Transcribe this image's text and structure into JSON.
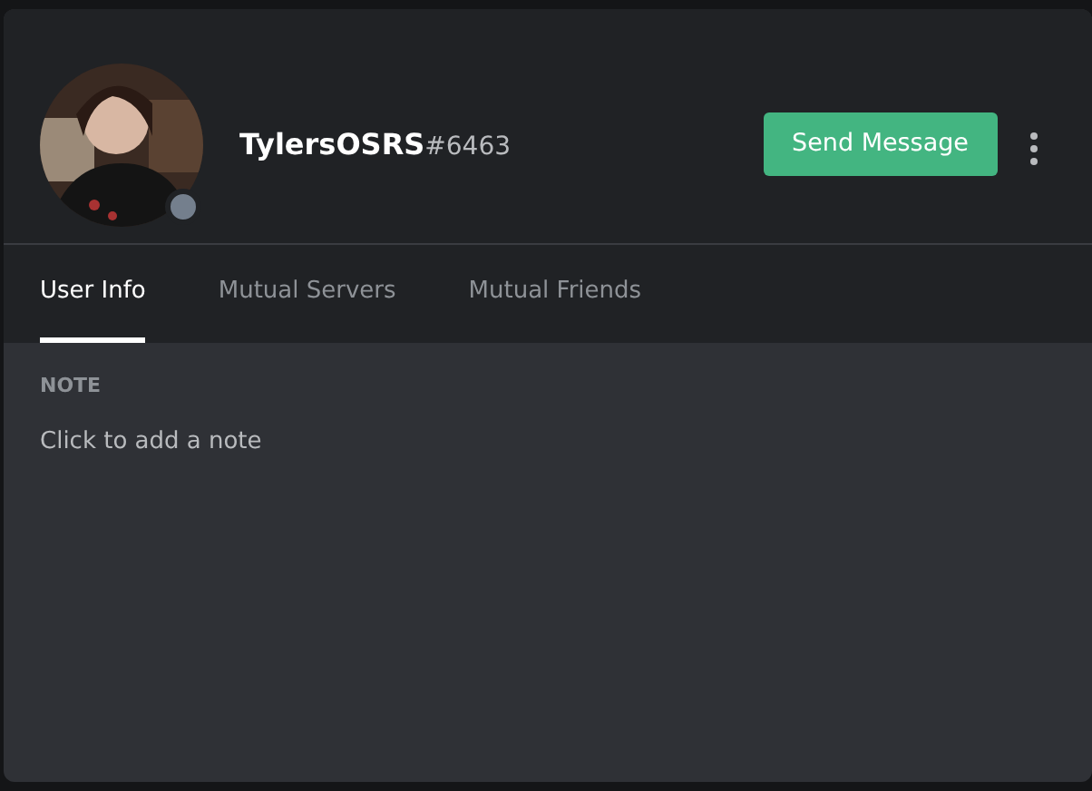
{
  "profile": {
    "username": "TylersOSRS",
    "discriminator": "#6463",
    "online": false
  },
  "actions": {
    "send_message": "Send Message"
  },
  "tabs": [
    {
      "label": "User Info",
      "selected": true
    },
    {
      "label": "Mutual Servers",
      "selected": false
    },
    {
      "label": "Mutual Friends",
      "selected": false
    }
  ],
  "note": {
    "heading": "NOTE",
    "placeholder": "Click to add a note"
  }
}
